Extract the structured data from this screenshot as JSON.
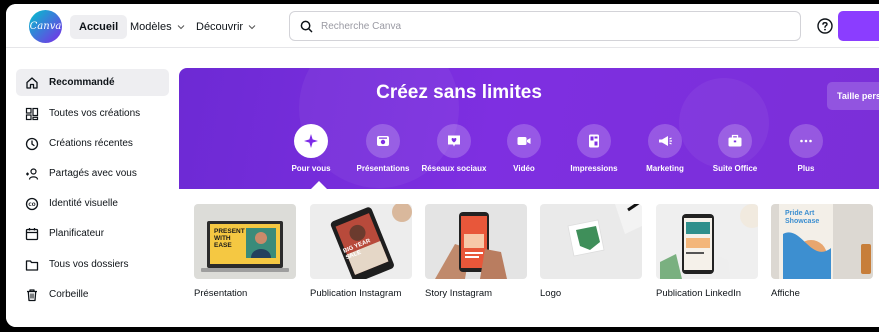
{
  "header": {
    "logo_text": "Canva",
    "nav": [
      {
        "label": "Accueil"
      },
      {
        "label": "Modèles"
      },
      {
        "label": "Découvrir"
      }
    ],
    "search_placeholder": "Recherche Canva",
    "accent": "#8b3dff"
  },
  "sidebar": {
    "items": [
      {
        "label": "Recommandé",
        "icon": "home-icon",
        "active": true
      },
      {
        "label": "Toutes vos créations",
        "icon": "grid-icon"
      },
      {
        "label": "Créations récentes",
        "icon": "clock-icon"
      },
      {
        "label": "Partagés avec vous",
        "icon": "people-icon"
      },
      {
        "label": "Identité visuelle",
        "icon": "brand-icon"
      },
      {
        "label": "Planificateur",
        "icon": "calendar-icon"
      },
      {
        "label": "Tous vos dossiers",
        "icon": "folder-icon"
      },
      {
        "label": "Corbeille",
        "icon": "trash-icon"
      }
    ]
  },
  "hero": {
    "title": "Créez sans limites",
    "custom_size_label": "Taille pers",
    "categories": [
      {
        "label": "Pour vous",
        "icon": "sparkle-icon",
        "active": true
      },
      {
        "label": "Présentations",
        "icon": "presentation-icon"
      },
      {
        "label": "Réseaux sociaux",
        "icon": "heart-message-icon"
      },
      {
        "label": "Vidéo",
        "icon": "video-camera-icon"
      },
      {
        "label": "Impressions",
        "icon": "print-icon"
      },
      {
        "label": "Marketing",
        "icon": "megaphone-icon"
      },
      {
        "label": "Suite Office",
        "icon": "briefcase-icon"
      },
      {
        "label": "Plus",
        "icon": "more-icon"
      }
    ]
  },
  "designs": [
    {
      "label": "Présentation",
      "thumb_text": "PRESENT WITH EASE"
    },
    {
      "label": "Publication Instagram",
      "thumb_text": "BIG YEAR SALE"
    },
    {
      "label": "Story Instagram",
      "thumb_text": ""
    },
    {
      "label": "Logo",
      "thumb_text": ""
    },
    {
      "label": "Publication LinkedIn",
      "thumb_text": ""
    },
    {
      "label": "Affiche",
      "thumb_text": "Pride Art Showcase"
    }
  ]
}
